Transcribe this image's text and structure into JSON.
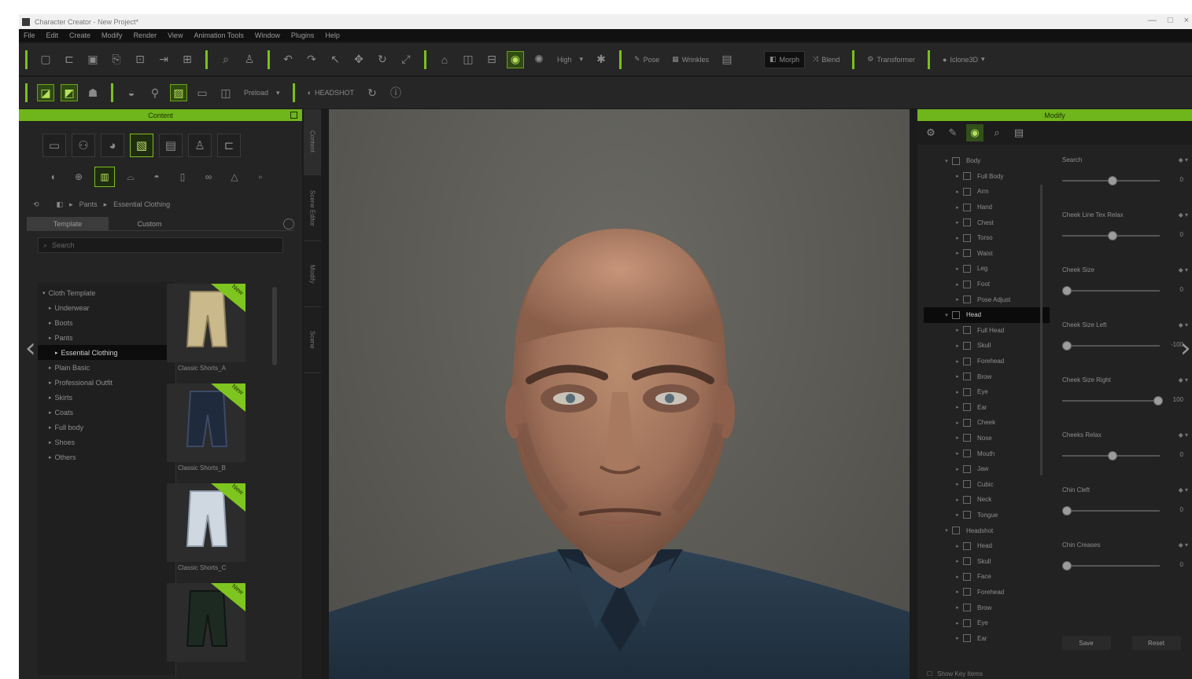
{
  "window": {
    "title": "Character Creator - New Project*",
    "controls": [
      "—",
      "□",
      "×"
    ]
  },
  "menu": [
    "File",
    "Edit",
    "Create",
    "Modify",
    "Render",
    "View",
    "Animation Tools",
    "Window",
    "Plugins",
    "Help"
  ],
  "toolbar1": {
    "quality_label": "High",
    "pose_label": "Pose",
    "morph_label": "Morph",
    "wrinkles_label": "Wrinkles",
    "blend_label": "Blend",
    "transform_label": "Transformer",
    "export_label": "Iclone3D"
  },
  "toolbar2": {
    "preset_combo": "Preload",
    "headshot_label": "HEADSHOT"
  },
  "left_panel": {
    "title": "Content",
    "breadcrumb": [
      "Pants",
      "Essential Clothing"
    ],
    "tabs": [
      "Template",
      "Custom"
    ],
    "search_placeholder": "Search",
    "tree": [
      {
        "label": "Cloth Template",
        "indent": 0
      },
      {
        "label": "Underwear",
        "indent": 1
      },
      {
        "label": "Boots",
        "indent": 1
      },
      {
        "label": "Pants",
        "indent": 1
      },
      {
        "label": "Essential Clothing",
        "indent": 2,
        "selected": true
      },
      {
        "label": "Plain Basic",
        "indent": 1
      },
      {
        "label": "Professional Outfit",
        "indent": 1
      },
      {
        "label": "Skirts",
        "indent": 1
      },
      {
        "label": "Coats",
        "indent": 1
      },
      {
        "label": "Full body",
        "indent": 1
      },
      {
        "label": "Shoes",
        "indent": 1
      },
      {
        "label": "Others",
        "indent": 1
      }
    ],
    "items": [
      {
        "label": "Classic Shorts_A",
        "badge": "New"
      },
      {
        "label": "Classic Shorts_B",
        "badge": "New"
      },
      {
        "label": "Classic Shorts_C",
        "badge": "New"
      },
      {
        "label": "",
        "badge": "New"
      }
    ]
  },
  "side_tabs": [
    "Content",
    "Scene Editor",
    "Modify",
    "Scene"
  ],
  "right_panel": {
    "title": "Modify",
    "tree": [
      {
        "label": "Body",
        "depth": 0,
        "expanded": true
      },
      {
        "label": "Full Body",
        "depth": 1
      },
      {
        "label": "Arm",
        "depth": 1
      },
      {
        "label": "Hand",
        "depth": 1
      },
      {
        "label": "Chest",
        "depth": 1
      },
      {
        "label": "Torso",
        "depth": 1
      },
      {
        "label": "Waist",
        "depth": 1
      },
      {
        "label": "Leg",
        "depth": 1
      },
      {
        "label": "Foot",
        "depth": 1
      },
      {
        "label": "Pose Adjust",
        "depth": 1
      },
      {
        "label": "Head",
        "depth": 0,
        "selected": true
      },
      {
        "label": "Full Head",
        "depth": 1
      },
      {
        "label": "Skull",
        "depth": 1
      },
      {
        "label": "Forehead",
        "depth": 1
      },
      {
        "label": "Brow",
        "depth": 1
      },
      {
        "label": "Eye",
        "depth": 1
      },
      {
        "label": "Ear",
        "depth": 1
      },
      {
        "label": "Cheek",
        "depth": 1
      },
      {
        "label": "Nose",
        "depth": 1
      },
      {
        "label": "Mouth",
        "depth": 1
      },
      {
        "label": "Jaw",
        "depth": 1
      },
      {
        "label": "Cubic",
        "depth": 1
      },
      {
        "label": "Neck",
        "depth": 1
      },
      {
        "label": "Tongue",
        "depth": 1
      },
      {
        "label": "Headshot",
        "depth": 0
      },
      {
        "label": "Head",
        "depth": 1
      },
      {
        "label": "Skull",
        "depth": 1
      },
      {
        "label": "Face",
        "depth": 1
      },
      {
        "label": "Forehead",
        "depth": 1
      },
      {
        "label": "Brow",
        "depth": 1
      },
      {
        "label": "Eye",
        "depth": 1
      },
      {
        "label": "Ear",
        "depth": 1
      }
    ],
    "sliders": [
      {
        "label": "Search",
        "value": "0",
        "fraction": 0.5
      },
      {
        "label": "Cheek Line Tex Relax",
        "value": "0",
        "fraction": 0.5
      },
      {
        "label": "Cheek Size",
        "value": "0",
        "fraction": 0.0
      },
      {
        "label": "Cheek Size Left",
        "value": "-100",
        "fraction": 0.0
      },
      {
        "label": "Cheek Size Right",
        "value": "100",
        "fraction": 1.0
      },
      {
        "label": "Cheeks Relax",
        "value": "0",
        "fraction": 0.5
      },
      {
        "label": "Chin Cleft",
        "value": "0",
        "fraction": 0.0
      },
      {
        "label": "Chin Creases",
        "value": "0",
        "fraction": 0.0
      }
    ],
    "buttons": [
      "Save",
      "Reset"
    ],
    "footer": "Show Key Items"
  },
  "colors": {
    "accent": "#6fb51c",
    "panel": "#242424",
    "viewport": "#5b5a55"
  }
}
